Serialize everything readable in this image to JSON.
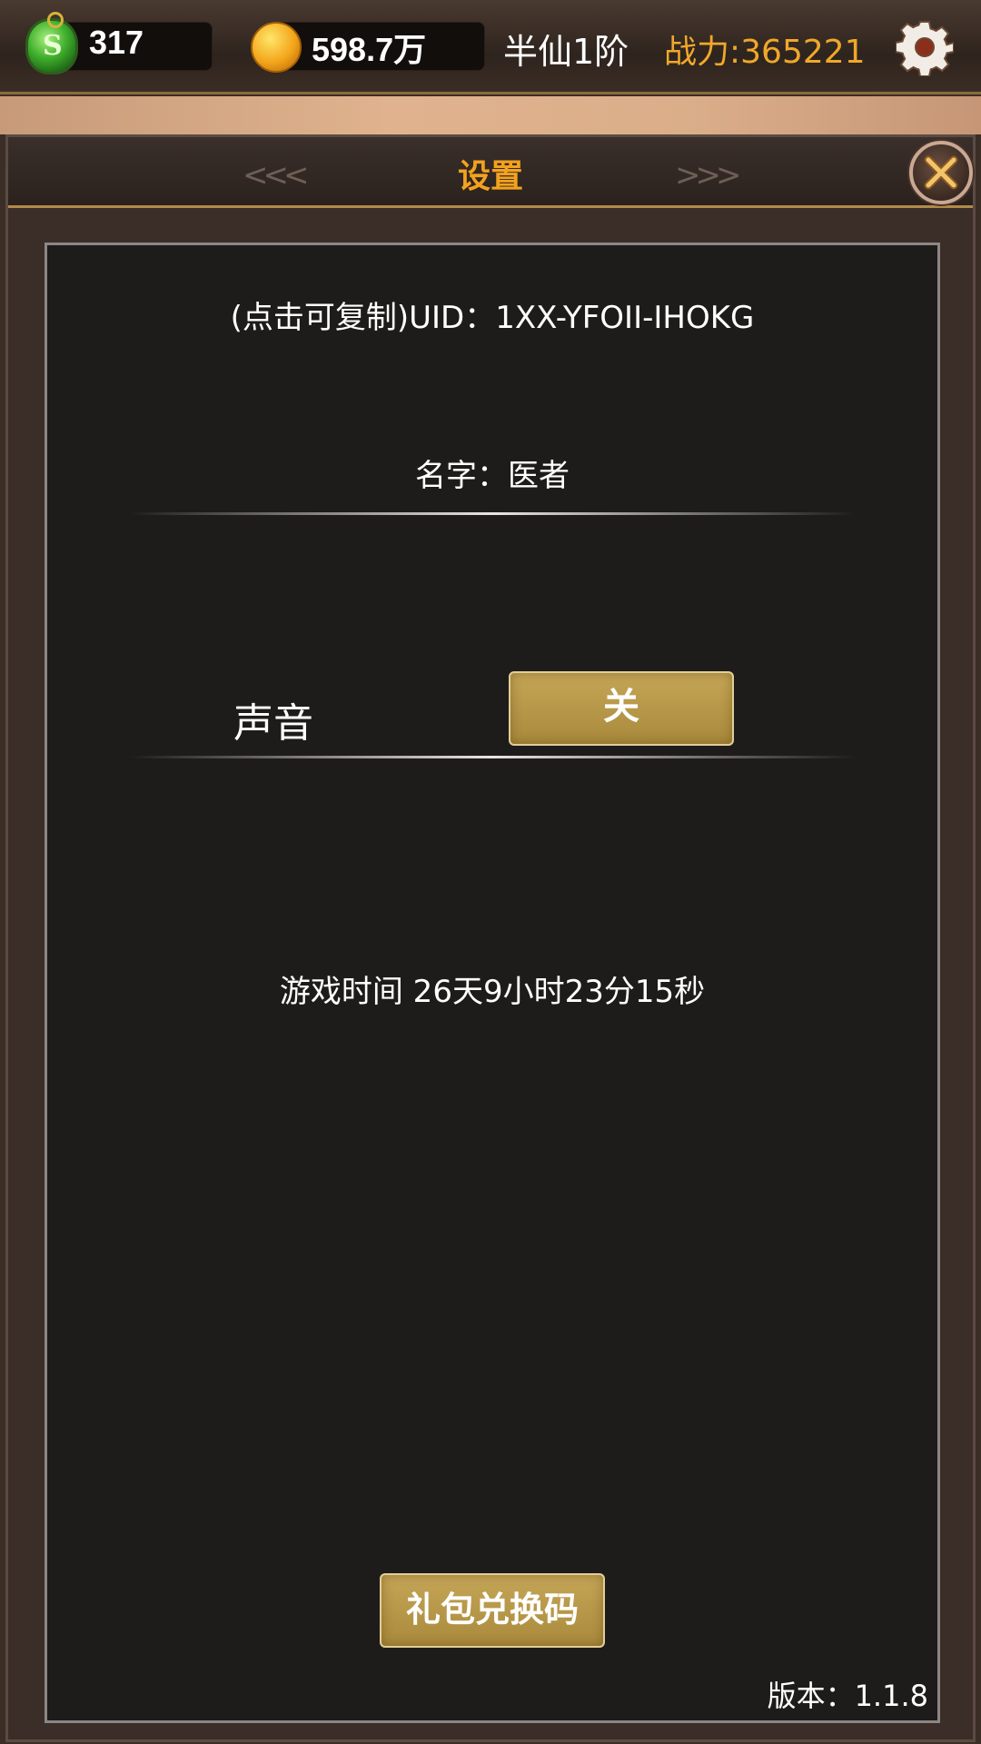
{
  "status_bar": {
    "jade_count": "317",
    "gold_amount": "598.7万",
    "rank": "半仙1阶",
    "power": "战力:365221",
    "icons": [
      "jade-icon",
      "gold-coin-icon",
      "gear-icon"
    ],
    "colors": {
      "power": "#f0a82a",
      "bar": "#2e241e"
    }
  },
  "dialog": {
    "title": "设置",
    "close_icon": "close-icon",
    "colors": {
      "title": "#f3a21e",
      "button": "#b3944a",
      "panel": "#1e1c1b"
    }
  },
  "settings": {
    "uid": "(点击可复制)UID：1XX-YFOII-IHOKG",
    "name": "名字：医者",
    "sound_label": "声音",
    "sound_toggle": "关",
    "play_time": "游戏时间 26天9小时23分15秒",
    "gift_code_button": "礼包兑换码",
    "version": "版本：1.1.8"
  }
}
